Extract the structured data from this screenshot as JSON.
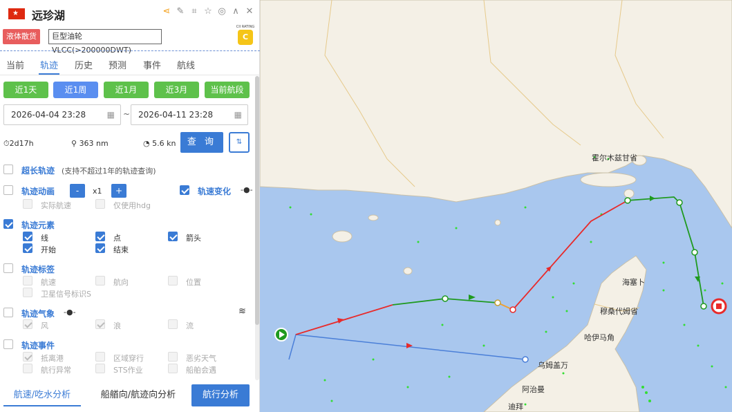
{
  "header": {
    "flag_symbol": "★",
    "ship_name": "远珍湖",
    "cargo_tag": "液体散货",
    "ship_type": "巨型油轮VLCC(>200000DWT)",
    "cii_label": "CII RATING",
    "cii_grade": "C"
  },
  "tabs": [
    "当前",
    "轨迹",
    "历史",
    "预测",
    "事件",
    "航线"
  ],
  "range_buttons": [
    "近1天",
    "近1周",
    "近1月",
    "近3月",
    "当前航段"
  ],
  "date_range": {
    "start": "2026-04-04 23:28",
    "end": "2026-04-11 23:28",
    "sep": "~"
  },
  "stats": {
    "duration": "2d17h",
    "distance": "363 nm",
    "speed": "5.6 kn"
  },
  "query_label": "查 询",
  "options": {
    "long_track": {
      "label": "超长轨迹",
      "note": "(支持不超过1年的轨迹查询)"
    },
    "animation": {
      "label": "轨迹动画",
      "minus": "-",
      "speed": "x1",
      "plus": "+"
    },
    "speed_change": {
      "label": "轨速变化"
    },
    "animation_subs": [
      "实际航速",
      "仅使用hdg"
    ],
    "elements": {
      "label": "轨迹元素",
      "subs": [
        "线",
        "点",
        "箭头",
        "开始",
        "结束"
      ]
    },
    "labels": {
      "label": "轨迹标签",
      "subs": [
        "航速",
        "航向",
        "位置",
        "卫星信号标识S"
      ]
    },
    "weather": {
      "label": "轨迹气象",
      "subs": [
        "风",
        "浪",
        "流"
      ]
    },
    "events": {
      "label": "轨迹事件",
      "subs": [
        "抵离港",
        "区域穿行",
        "恶劣天气",
        "航行异常",
        "STS作业",
        "船舶会遇"
      ]
    }
  },
  "bottom": {
    "tab1": "航速/吃水分析",
    "tab2": "船艏向/航迹向分析",
    "analyze": "航行分析"
  },
  "map_labels": {
    "province": "霍尔木兹甘省",
    "island": "海塞卜",
    "musandam": "穆桑代姆省",
    "khasab": "哈伊马角",
    "umm": "乌姆盖万",
    "ajman": "阿治曼",
    "dubai": "迪拜"
  },
  "colors": {
    "accent": "#3a7bd5",
    "green_btn": "#5ec14b",
    "track_red": "#e82a2a",
    "track_green": "#1f9a1f",
    "track_blue": "#4a7fd8"
  }
}
